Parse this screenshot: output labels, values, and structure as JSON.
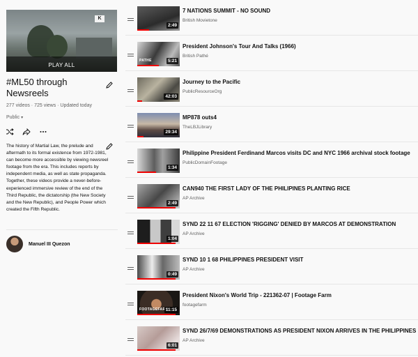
{
  "playlist": {
    "play_all_label": "PLAY ALL",
    "hero_badge": "K",
    "title": "#ML50 through Newsreels",
    "meta": "277 videos · 725 views · Updated today",
    "visibility": "Public",
    "description": "The history of Martial Law, the prelude and aftermath to its formal existence from 1972-1981, can become more accessible by viewing newsreel footage from the era. This includes reports by independent media, as well as state propaganda. Together, these videos provide a never-before-experienced immersive review of the end of the Third Republic, the dictatorship (the New Society and the New Republic), and People Power which created the Fifth Republic.",
    "owner": "Manuel III Quezon"
  },
  "videos": [
    {
      "title": "7 NATIONS SUMMIT - NO SOUND",
      "channel": "British Movietone",
      "duration": "2:49",
      "watched": 0.28,
      "watermark": ""
    },
    {
      "title": "President Johnson's Tour And Talks (1966)",
      "channel": "British Pathé",
      "duration": "5:21",
      "watched": 0.5,
      "watermark": "PATHE"
    },
    {
      "title": "Journey to the Pacific",
      "channel": "PublicResourceOrg",
      "duration": "42:03",
      "watched": 0.12,
      "watermark": ""
    },
    {
      "title": "MP878 outs4",
      "channel": "TheLBJLibrary",
      "duration": "29:34",
      "watched": 0.15,
      "watermark": ""
    },
    {
      "title": "Philippine President Ferdinand Marcos visits DC and NYC 1966 archival stock footage",
      "channel": "PublicDomainFootage",
      "duration": "1:34",
      "watched": 0.45,
      "watermark": ""
    },
    {
      "title": "CAN940 THE FIRST LADY OF THE PHILIPINES PLANTING RICE",
      "channel": "AP Archive",
      "duration": "2:49",
      "watched": 0.9,
      "watermark": ""
    },
    {
      "title": "SYND 22 11 67 ELECTION 'RIGGING' DENIED BY MARCOS AT DEMONSTRATION",
      "channel": "AP Archive",
      "duration": "1:04",
      "watched": 0.9,
      "watermark": ""
    },
    {
      "title": "SYND 10 1 68 PHILIPPINES PRESIDENT VISIT",
      "channel": "AP Archive",
      "duration": "0:49",
      "watched": 0.9,
      "watermark": ""
    },
    {
      "title": "President Nixon's World Trip - 221362-07 | Footage Farm",
      "channel": "footagefarm",
      "duration": "11:15",
      "watched": 0.9,
      "watermark": "FOOTAGEFARM"
    },
    {
      "title": "SYND 26/7/69 DEMONSTRATIONS AS PRESIDENT NIXON ARRIVES IN THE PHILIPPINES",
      "channel": "AP Archive",
      "duration": "6:01",
      "watched": 0.9,
      "watermark": ""
    }
  ]
}
